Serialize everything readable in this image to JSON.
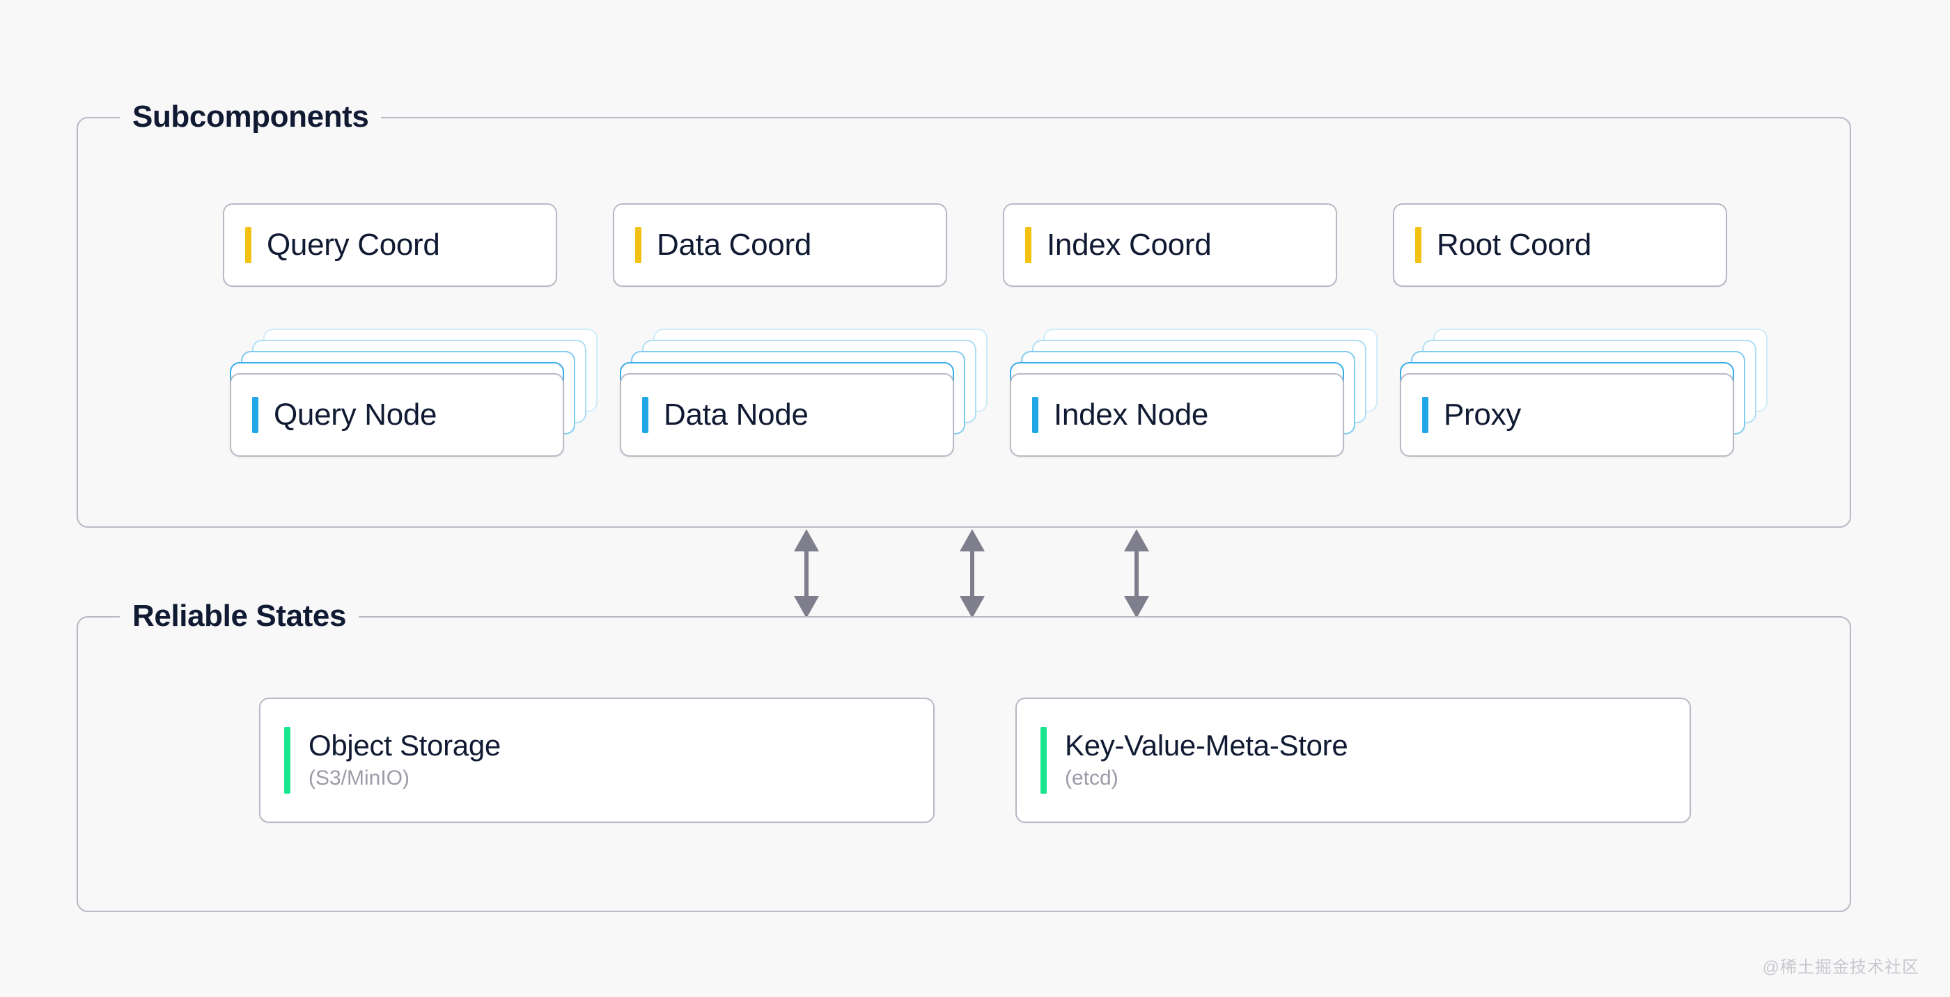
{
  "background_color": "#F8F8F8",
  "colors": {
    "coordinator_accent": "#F2C111",
    "node_accent": "#22A7E6",
    "storage_accent": "#19E68F",
    "text_primary": "#101a32",
    "text_muted": "#9b9ba8",
    "border": "#B9B9C6",
    "arrow": "#7E7E8C"
  },
  "groups": {
    "subcomponents": {
      "label": "Subcomponents",
      "coordinators": [
        {
          "title": "Query Coord"
        },
        {
          "title": "Data Coord"
        },
        {
          "title": "Index Coord"
        },
        {
          "title": "Root Coord"
        }
      ],
      "nodes": [
        {
          "title": "Query Node",
          "stack_layers": 4
        },
        {
          "title": "Data Node",
          "stack_layers": 4
        },
        {
          "title": "Index Node",
          "stack_layers": 4
        },
        {
          "title": "Proxy",
          "stack_layers": 4
        }
      ]
    },
    "reliable_states": {
      "label": "Reliable States",
      "stores": [
        {
          "title": "Object Storage",
          "subtitle": "(S3/MinIO)"
        },
        {
          "title": "Key-Value-Meta-Store",
          "subtitle": "(etcd)"
        }
      ]
    }
  },
  "connectors": {
    "count": 3,
    "style": "double-headed-vertical-arrow",
    "direction": "bidirectional"
  },
  "watermark": {
    "text": "@稀土掘金技术社区"
  }
}
